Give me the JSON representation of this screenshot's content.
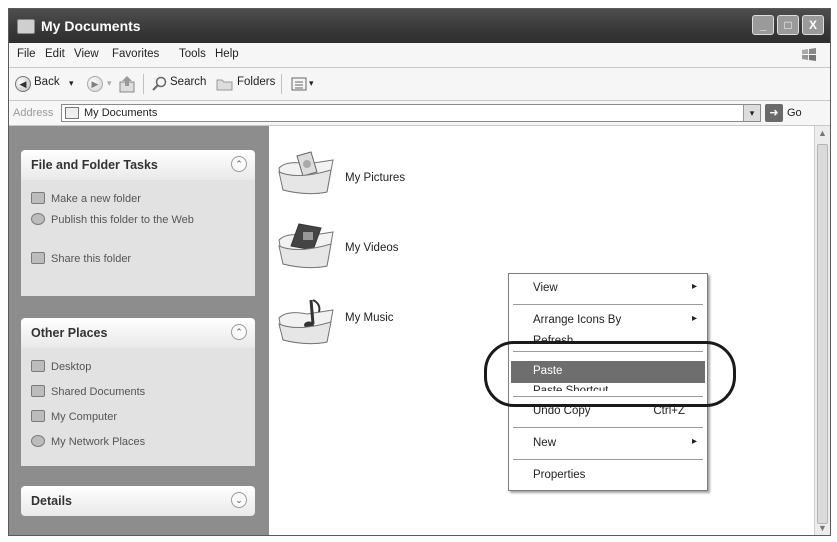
{
  "window": {
    "title": "My Documents",
    "controls": [
      "_",
      "□",
      "X"
    ]
  },
  "menu": [
    "File",
    "Edit",
    "View",
    "Favorites",
    "Tools",
    "Help"
  ],
  "toolbar": {
    "back": "Back",
    "search": "Search",
    "folders": "Folders"
  },
  "address": {
    "label": "Address",
    "value": "My Documents",
    "go": "Go"
  },
  "panels": {
    "file_tasks": {
      "title": "File and Folder Tasks",
      "items": [
        "Make a new folder",
        "Publish this folder to the Web",
        "Share this folder"
      ]
    },
    "other_places": {
      "title": "Other Places",
      "items": [
        "Desktop",
        "Shared Documents",
        "My Computer",
        "My Network Places"
      ]
    },
    "details": {
      "title": "Details"
    }
  },
  "folders": [
    "My Pictures",
    "My Videos",
    "My Music"
  ],
  "context_menu": {
    "view": "View",
    "arrange": "Arrange Icons By",
    "refresh": "Refresh",
    "paste": "Paste",
    "paste_shortcut": "Paste Shortcut",
    "undo": "Undo Copy",
    "undo_shortcut": "Ctrl+Z",
    "new": "New",
    "properties": "Properties"
  },
  "icons": {
    "submenu_arrow": "▸",
    "collapse": "⌃",
    "expand": "⌄",
    "dropdown": "▾"
  }
}
